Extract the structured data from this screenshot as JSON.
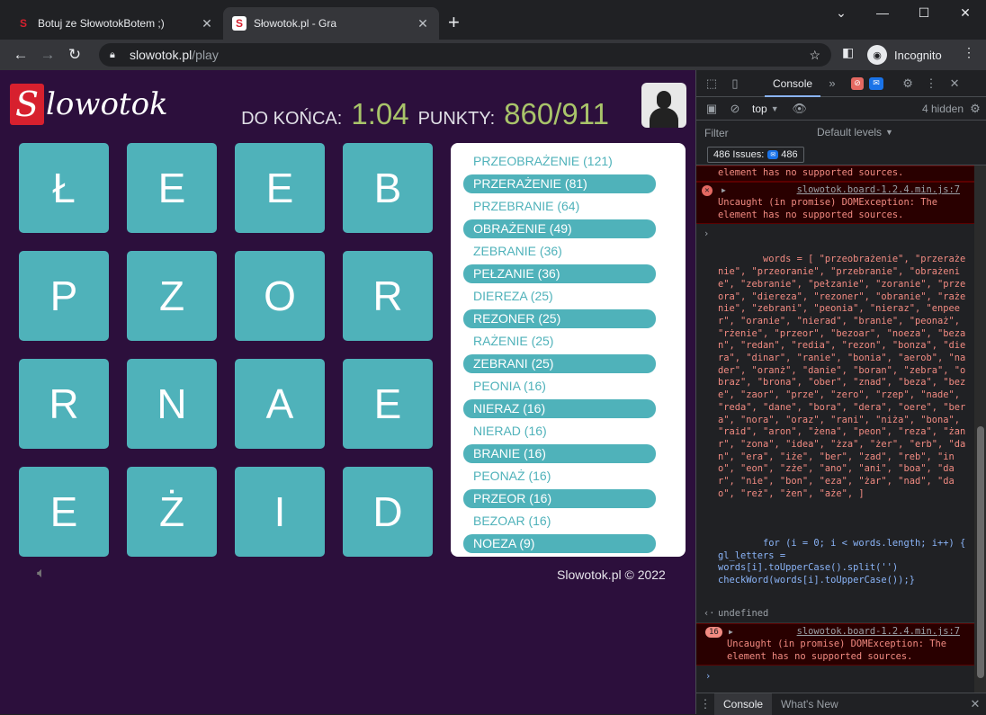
{
  "browser": {
    "tabs": [
      {
        "title": "Botuj ze SłowotokBotem ;)",
        "favicon": "S"
      },
      {
        "title": "Słowotok.pl - Gra",
        "favicon": "S"
      }
    ],
    "url_host": "slowotok.pl",
    "url_path": "/play",
    "incognito_label": "Incognito"
  },
  "game": {
    "logo_text": "lowotok",
    "logo_letter": "S",
    "time_label": "DO KOŃCA:",
    "time_value": "1:04",
    "points_label": "PUNKTY:",
    "points_value": "860/911",
    "board": [
      "Ł",
      "E",
      "E",
      "B",
      "P",
      "Z",
      "O",
      "R",
      "R",
      "N",
      "A",
      "E",
      "E",
      "Ż",
      "I",
      "D"
    ],
    "words": [
      {
        "text": "PRZEOBRAŻENIE (121)",
        "found": false
      },
      {
        "text": "PRZERAŻENIE (81)",
        "found": true
      },
      {
        "text": "PRZEBRANIE (64)",
        "found": false
      },
      {
        "text": "OBRAŻENIE (49)",
        "found": true
      },
      {
        "text": "ZEBRANIE (36)",
        "found": false
      },
      {
        "text": "PEŁZANIE (36)",
        "found": true
      },
      {
        "text": "DIEREZA (25)",
        "found": false
      },
      {
        "text": "REZONER (25)",
        "found": true
      },
      {
        "text": "RAŻENIE (25)",
        "found": false
      },
      {
        "text": "ZEBRANI (25)",
        "found": true
      },
      {
        "text": "PEONIA (16)",
        "found": false
      },
      {
        "text": "NIERAZ (16)",
        "found": true
      },
      {
        "text": "NIERAD (16)",
        "found": false
      },
      {
        "text": "BRANIE (16)",
        "found": true
      },
      {
        "text": "PEONAŻ (16)",
        "found": false
      },
      {
        "text": "PRZEOR (16)",
        "found": true
      },
      {
        "text": "BEZOAR (16)",
        "found": false
      },
      {
        "text": "NOEZA (9)",
        "found": true
      }
    ],
    "footer": "Slowotok.pl © 2022"
  },
  "devtools": {
    "tab_console": "Console",
    "context": "top",
    "hidden_count": "4 hidden",
    "filter_placeholder": "Filter",
    "levels": "Default levels",
    "issues_label": "486 Issues:",
    "issues_count": "486",
    "error_top_tail": "element has no supported sources.",
    "error1_src": "slowotok.board-1.2.4.min.js:7",
    "error1_msg": "Uncaught (in promise) DOMException: The element has no supported sources.",
    "cmd_words": "words = [ \"przeobrażenie\", \"przerażenie\", \"przeoranie\", \"przebranie\", \"obrażenie\", \"zebranie\", \"pełzanie\", \"zoranie\", \"przeora\", \"diereza\", \"rezoner\", \"obranie\", \"rażenie\", \"zebrani\", \"peonia\", \"nieraz\", \"enpeer\", \"oranie\", \"nierad\", \"branie\", \"peonaż\", \"rżenie\", \"przeor\", \"bezoar\", \"noeza\", \"bezan\", \"redan\", \"redia\", \"rezon\", \"bonza\", \"diera\", \"dinar\", \"ranie\", \"bonia\", \"aerob\", \"nader\", \"oranż\", \"danie\", \"boran\", \"zebra\", \"obraz\", \"brona\", \"ober\", \"znad\", \"beza\", \"beze\", \"zaor\", \"prze\", \"zero\", \"rzep\", \"nade\", \"reda\", \"dane\", \"bora\", \"dera\", \"oere\", \"bera\", \"nora\", \"oraz\", \"rani\", \"niża\", \"bona\", \"raid\", \"aron\", \"żena\", \"peon\", \"reza\", \"żanr\", \"zona\", \"idea\", \"żza\", \"żer\", \"erb\", \"dan\", \"era\", \"iże\", \"ber\", \"zad\", \"reb\", \"ino\", \"eon\", \"zże\", \"ano\", \"ani\", \"boa\", \"dar\", \"nie\", \"bon\", \"eza\", \"żar\", \"nad\", \"dao\", \"reż\", \"żen\", \"aże\", ]",
    "cmd_loop": "for (i = 0; i < words.length; i++) {\ngl_letters =\nwords[i].toUpperCase().split('')\ncheckWord(words[i].toUpperCase());}",
    "result": "undefined",
    "error2_count": "16",
    "error2_src": "slowotok.board-1.2.4.min.js:7",
    "error2_msg": "Uncaught (in promise) DOMException: The element has no supported sources.",
    "drawer_console": "Console",
    "drawer_whatsnew": "What's New"
  }
}
